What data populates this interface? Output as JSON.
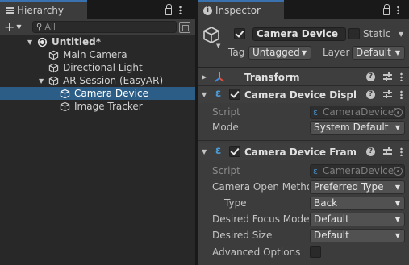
{
  "hierarchy": {
    "tab_label": "Hierarchy",
    "search_placeholder": "All",
    "add_label": "+",
    "items": [
      {
        "label": "Untitled*",
        "kind": "scene",
        "depth": 0,
        "expanded": true
      },
      {
        "label": "Main Camera",
        "kind": "gameobject",
        "depth": 1
      },
      {
        "label": "Directional Light",
        "kind": "gameobject",
        "depth": 1
      },
      {
        "label": "AR Session (EasyAR)",
        "kind": "gameobject",
        "depth": 1,
        "expanded": true
      },
      {
        "label": "Camera Device",
        "kind": "gameobject",
        "depth": 2,
        "selected": true
      },
      {
        "label": "Image Tracker",
        "kind": "gameobject",
        "depth": 2
      }
    ]
  },
  "inspector": {
    "tab_label": "Inspector",
    "object_name": "Camera Device",
    "active": true,
    "static_label": "Static",
    "static_checked": false,
    "tag_label": "Tag",
    "tag_value": "Untagged",
    "layer_label": "Layer",
    "layer_value": "Default",
    "components": [
      {
        "title": "Transform",
        "has_toggle": false,
        "expanded": false
      },
      {
        "title": "Camera Device Display (",
        "has_toggle": true,
        "enabled": true,
        "expanded": true,
        "fields": [
          {
            "label": "Script",
            "kind": "script",
            "value": "CameraDeviceI"
          },
          {
            "label": "Mode",
            "kind": "dropdown",
            "value": "System Default"
          }
        ]
      },
      {
        "title": "Camera Device Frame S",
        "has_toggle": true,
        "enabled": true,
        "expanded": true,
        "fields": [
          {
            "label": "Script",
            "kind": "script",
            "value": "CameraDeviceI"
          },
          {
            "label": "Camera Open Metho",
            "kind": "dropdown",
            "value": "Preferred Type"
          },
          {
            "label": "Type",
            "kind": "dropdown",
            "value": "Back",
            "indent": true
          },
          {
            "label": "Desired Focus Mode",
            "kind": "dropdown",
            "value": "Default"
          },
          {
            "label": "Desired Size",
            "kind": "dropdown",
            "value": "Default"
          },
          {
            "label": "Advanced Options",
            "kind": "checkbox",
            "value": false
          }
        ]
      }
    ]
  },
  "colors": {
    "selection": "#2c5d87",
    "panel": "#3c3c3c",
    "hierarchy_bg": "#282828",
    "script_icon": "#4b9bd6"
  }
}
